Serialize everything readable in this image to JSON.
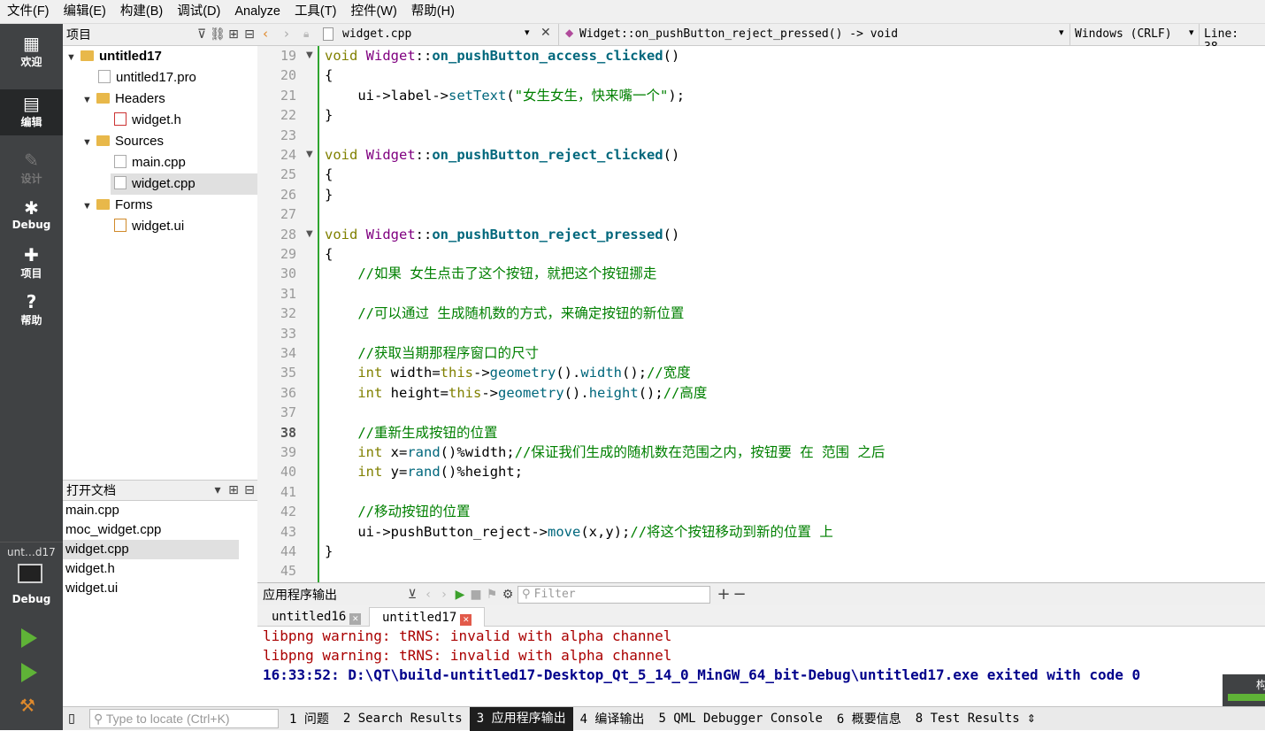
{
  "menu": [
    "文件(F)",
    "编辑(E)",
    "构建(B)",
    "调试(D)",
    "Analyze",
    "工具(T)",
    "控件(W)",
    "帮助(H)"
  ],
  "modes": [
    {
      "label": "欢迎",
      "icon": "grid-icon"
    },
    {
      "label": "编辑",
      "icon": "edit-icon"
    },
    {
      "label": "设计",
      "icon": "pencil-icon"
    },
    {
      "label": "Debug",
      "icon": "bug-icon"
    },
    {
      "label": "项目",
      "icon": "wrench-icon"
    },
    {
      "label": "帮助",
      "icon": "help-icon"
    }
  ],
  "kit": {
    "project": "unt…d17",
    "mode": "Debug"
  },
  "project_panel": {
    "title": "项目",
    "tree": [
      {
        "label": "untitled17",
        "type": "project",
        "bold": true
      },
      {
        "label": "untitled17.pro",
        "type": "pro-file"
      },
      {
        "label": "Headers",
        "type": "folder"
      },
      {
        "label": "widget.h",
        "type": "header-file"
      },
      {
        "label": "Sources",
        "type": "folder"
      },
      {
        "label": "main.cpp",
        "type": "cpp-file"
      },
      {
        "label": "widget.cpp",
        "type": "cpp-file",
        "selected": true
      },
      {
        "label": "Forms",
        "type": "folder"
      },
      {
        "label": "widget.ui",
        "type": "ui-file"
      }
    ]
  },
  "open_docs": {
    "title": "打开文档",
    "items": [
      {
        "label": "main.cpp"
      },
      {
        "label": "moc_widget.cpp"
      },
      {
        "label": "widget.cpp",
        "selected": true
      },
      {
        "label": "widget.h"
      },
      {
        "label": "widget.ui"
      }
    ]
  },
  "editor": {
    "file": "widget.cpp",
    "symbol": "Widget::on_pushButton_reject_pressed() -> void",
    "line_ending": "Windows (CRLF)",
    "position": "Line: 38,",
    "current_line": "38",
    "lines": [
      {
        "n": "19",
        "t": "void Widget::on_pushButton_access_clicked()",
        "fold": true
      },
      {
        "n": "20",
        "t": "{"
      },
      {
        "n": "21",
        "t": "    ui->label->setText(\"女生女生，快来嘴一个\");"
      },
      {
        "n": "22",
        "t": "}"
      },
      {
        "n": "23",
        "t": ""
      },
      {
        "n": "24",
        "t": "void Widget::on_pushButton_reject_clicked()",
        "fold": true
      },
      {
        "n": "25",
        "t": "{"
      },
      {
        "n": "26",
        "t": "}"
      },
      {
        "n": "27",
        "t": ""
      },
      {
        "n": "28",
        "t": "void Widget::on_pushButton_reject_pressed()",
        "fold": true
      },
      {
        "n": "29",
        "t": "{"
      },
      {
        "n": "30",
        "t": "    //如果 女生点击了这个按钮，就把这个按钮挪走"
      },
      {
        "n": "31",
        "t": ""
      },
      {
        "n": "32",
        "t": "    //可以通过 生成随机数的方式，来确定按钮的新位置"
      },
      {
        "n": "33",
        "t": ""
      },
      {
        "n": "34",
        "t": "    //获取当期那程序窗口的尺寸"
      },
      {
        "n": "35",
        "t": "    int width=this->geometry().width();//宽度"
      },
      {
        "n": "36",
        "t": "    int height=this->geometry().height();//高度"
      },
      {
        "n": "37",
        "t": ""
      },
      {
        "n": "38",
        "t": "    //重新生成按钮的位置"
      },
      {
        "n": "39",
        "t": "    int x=rand()%width;//保证我们生成的随机数在范围之内，按钮要 在 范围 之后"
      },
      {
        "n": "40",
        "t": "    int y=rand()%height;"
      },
      {
        "n": "41",
        "t": ""
      },
      {
        "n": "42",
        "t": "    //移动按钮的位置"
      },
      {
        "n": "43",
        "t": "    ui->pushButton_reject->move(x,y);//将这个按钮移动到新的位置 上"
      },
      {
        "n": "44",
        "t": "}"
      },
      {
        "n": "45",
        "t": ""
      }
    ]
  },
  "output": {
    "title": "应用程序输出",
    "filter_placeholder": "Filter",
    "tabs": [
      {
        "label": "untitled16",
        "active": false
      },
      {
        "label": "untitled17",
        "active": true
      }
    ],
    "lines": [
      {
        "t": "libpng warning: tRNS: invalid with alpha channel",
        "color": "#aa0000",
        "bold": false
      },
      {
        "t": "libpng warning: tRNS: invalid with alpha channel",
        "color": "#aa0000",
        "bold": false
      },
      {
        "t": "16:33:52: D:\\QT\\build-untitled17-Desktop_Qt_5_14_0_MinGW_64_bit-Debug\\untitled17.exe exited with code 0",
        "color": "#00008b",
        "bold": true
      }
    ]
  },
  "statusbar": {
    "locator_placeholder": "Type to locate (Ctrl+K)",
    "panes": [
      {
        "label": "1 问题"
      },
      {
        "label": "2 Search Results"
      },
      {
        "label": "3 应用程序输出",
        "active": true
      },
      {
        "label": "4 编译输出"
      },
      {
        "label": "5 QML Debugger Console"
      },
      {
        "label": "6 概要信息"
      },
      {
        "label": "8 Test Results"
      }
    ],
    "corner": "构"
  }
}
